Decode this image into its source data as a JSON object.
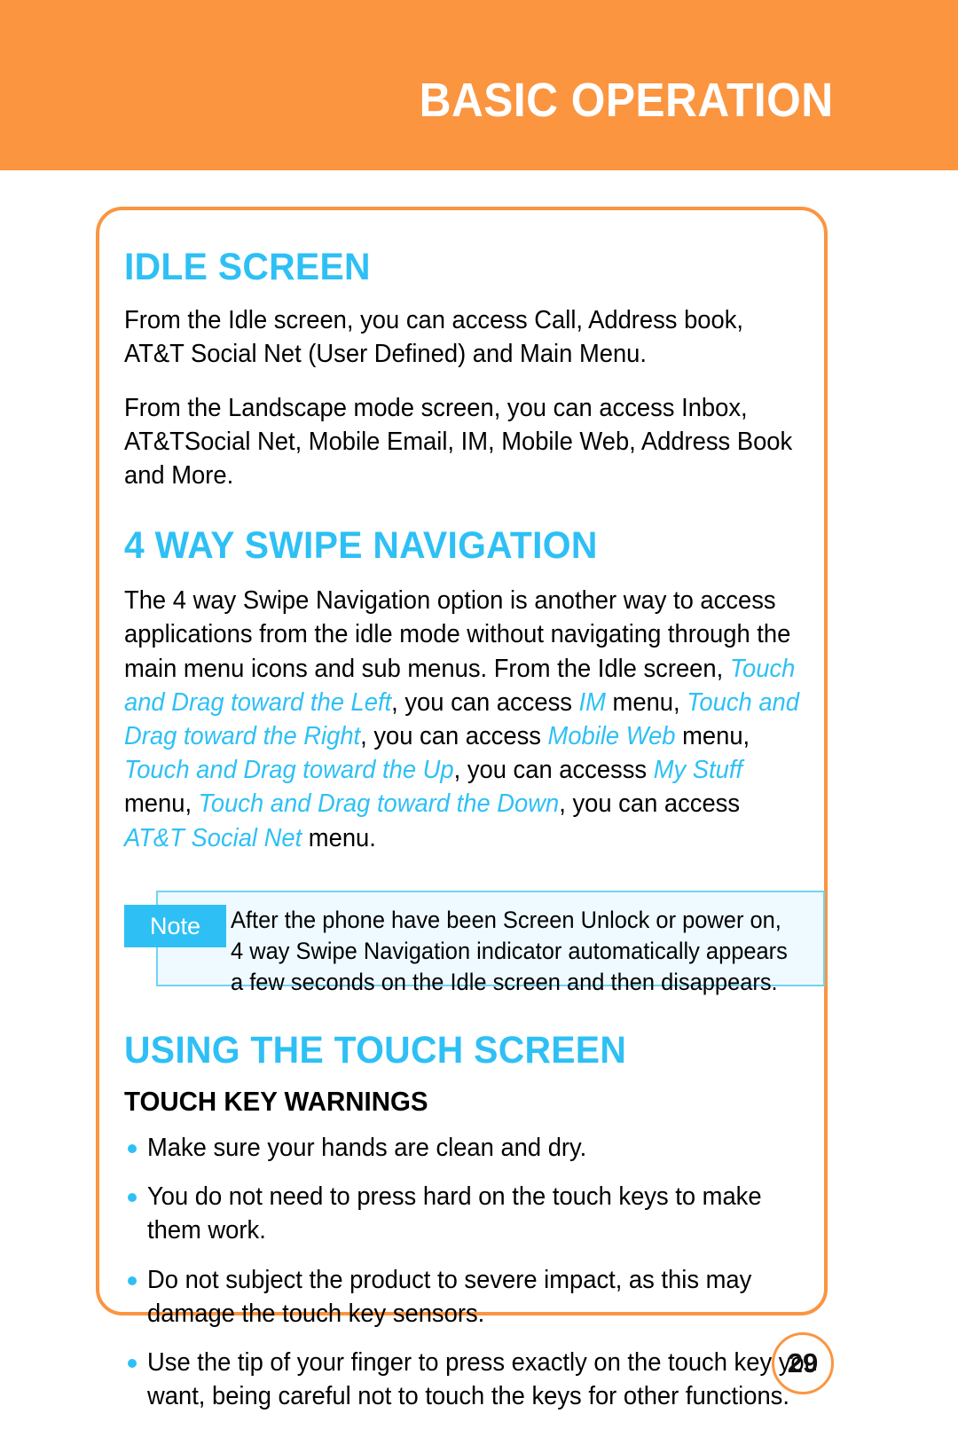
{
  "header": {
    "title": "BASIC OPERATION",
    "band_color": "#fb9540"
  },
  "theme": {
    "accent_orange": "#fb9540",
    "accent_blue": "#2ec0f5",
    "note_bg": "#eefaff",
    "note_border": "#6fd3f5"
  },
  "sections": {
    "idle_screen": {
      "heading": "IDLE SCREEN",
      "paragraph_1": "From the Idle screen, you can access Call, Address book, AT&T Social Net (User Defined) and Main Menu.",
      "paragraph_2": "From the Landscape mode screen, you can access Inbox, AT&TSocial Net, Mobile Email, IM, Mobile Web, Address Book and More."
    },
    "swipe_navigation": {
      "heading": "4 WAY SWIPE NAVIGATION",
      "paragraph_parts": {
        "t1": "The 4 way Swipe Navigation option is another way to access applications from the idle mode without navigating through the main menu icons and sub menus. From the Idle screen, ",
        "h1": "Touch and Drag toward the Left",
        "t2": ", you can access ",
        "h2": "IM",
        "t3": " menu, ",
        "h3": "Touch and Drag toward the Right",
        "t4": ", you can access ",
        "h4": "Mobile Web",
        "t5": " menu, ",
        "h5": "Touch and Drag toward the Up",
        "t6": ", you can accesss ",
        "h6": "My Stuff",
        "t7": " menu, ",
        "h7": "Touch and Drag toward the Down",
        "t8": ", you can access ",
        "h8": "AT&T Social Net",
        "t9": " menu."
      },
      "note": {
        "badge": "Note",
        "text": "After the phone have been Screen Unlock or power on, 4 way Swipe Navigation indicator automatically appears a few seconds on the Idle screen and then disappears."
      }
    },
    "touch_screen": {
      "heading": "USING THE TOUCH SCREEN",
      "subheading": "TOUCH KEY WARNINGS",
      "bullets": [
        "Make sure your hands are clean and dry.",
        "You do not need to press hard on the touch keys to make them work.",
        "Do not subject the product to severe impact, as this may damage the touch key sensors.",
        "Use the tip of your finger to press exactly on the touch key you want, being careful not to touch the keys for other functions."
      ]
    }
  },
  "footer": {
    "page_number": "29"
  }
}
